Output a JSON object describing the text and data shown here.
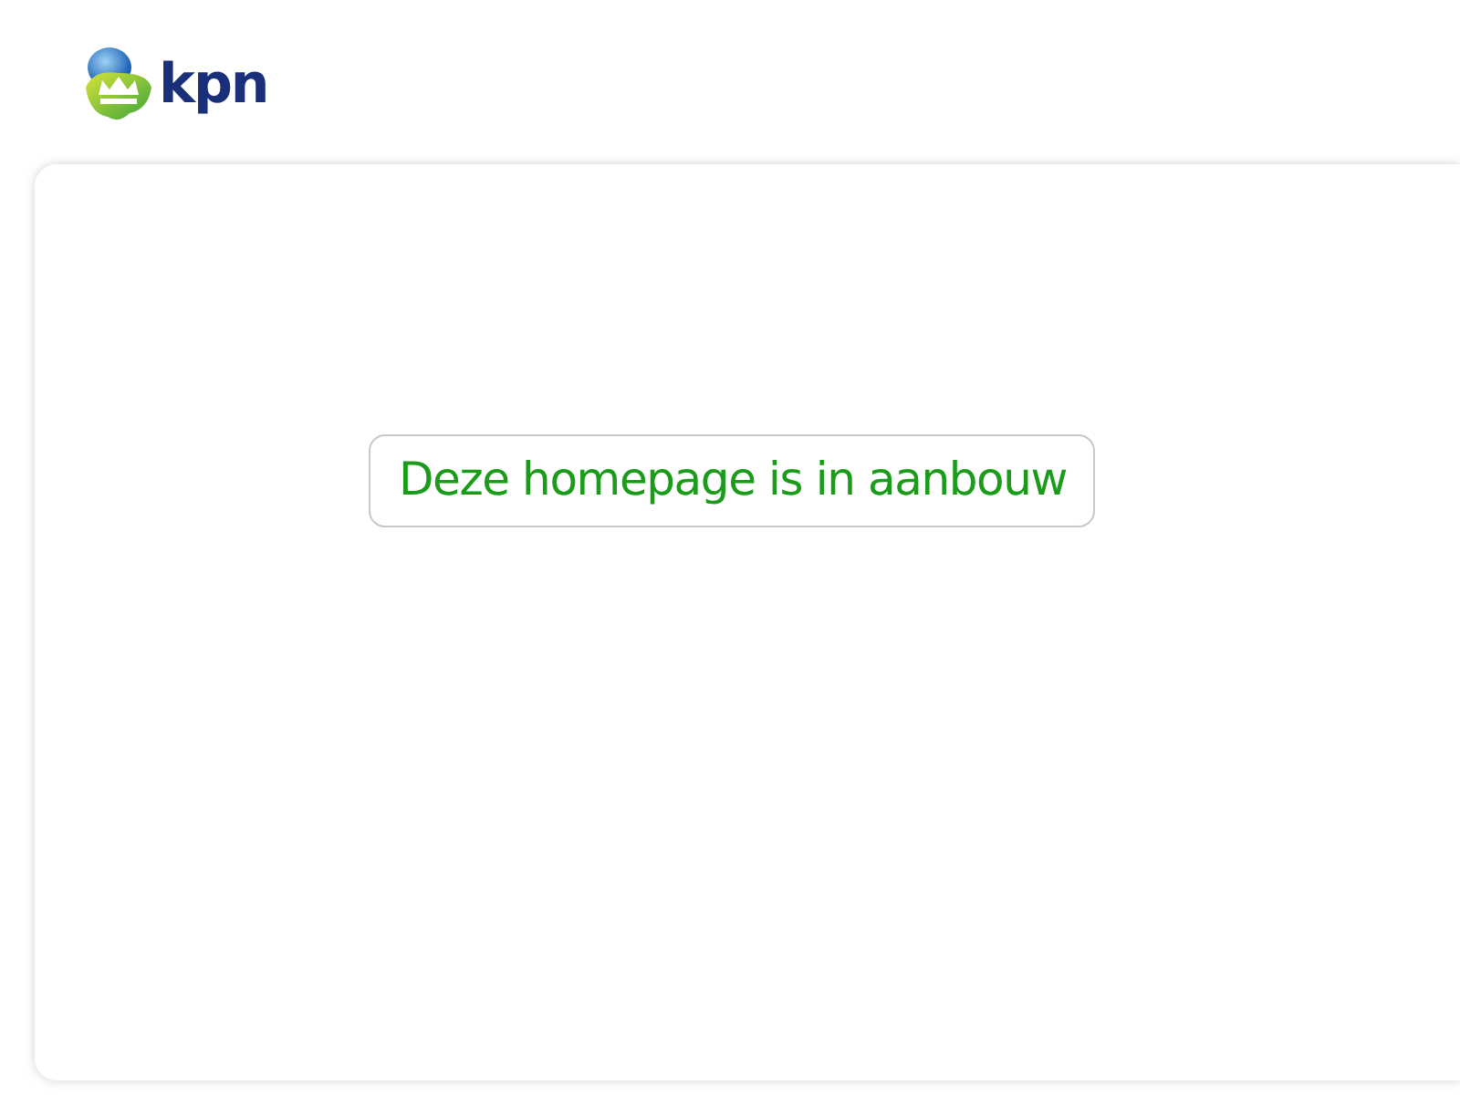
{
  "header": {
    "logo_text": "kpn"
  },
  "message": "Deze homepage is in aanbouw"
}
